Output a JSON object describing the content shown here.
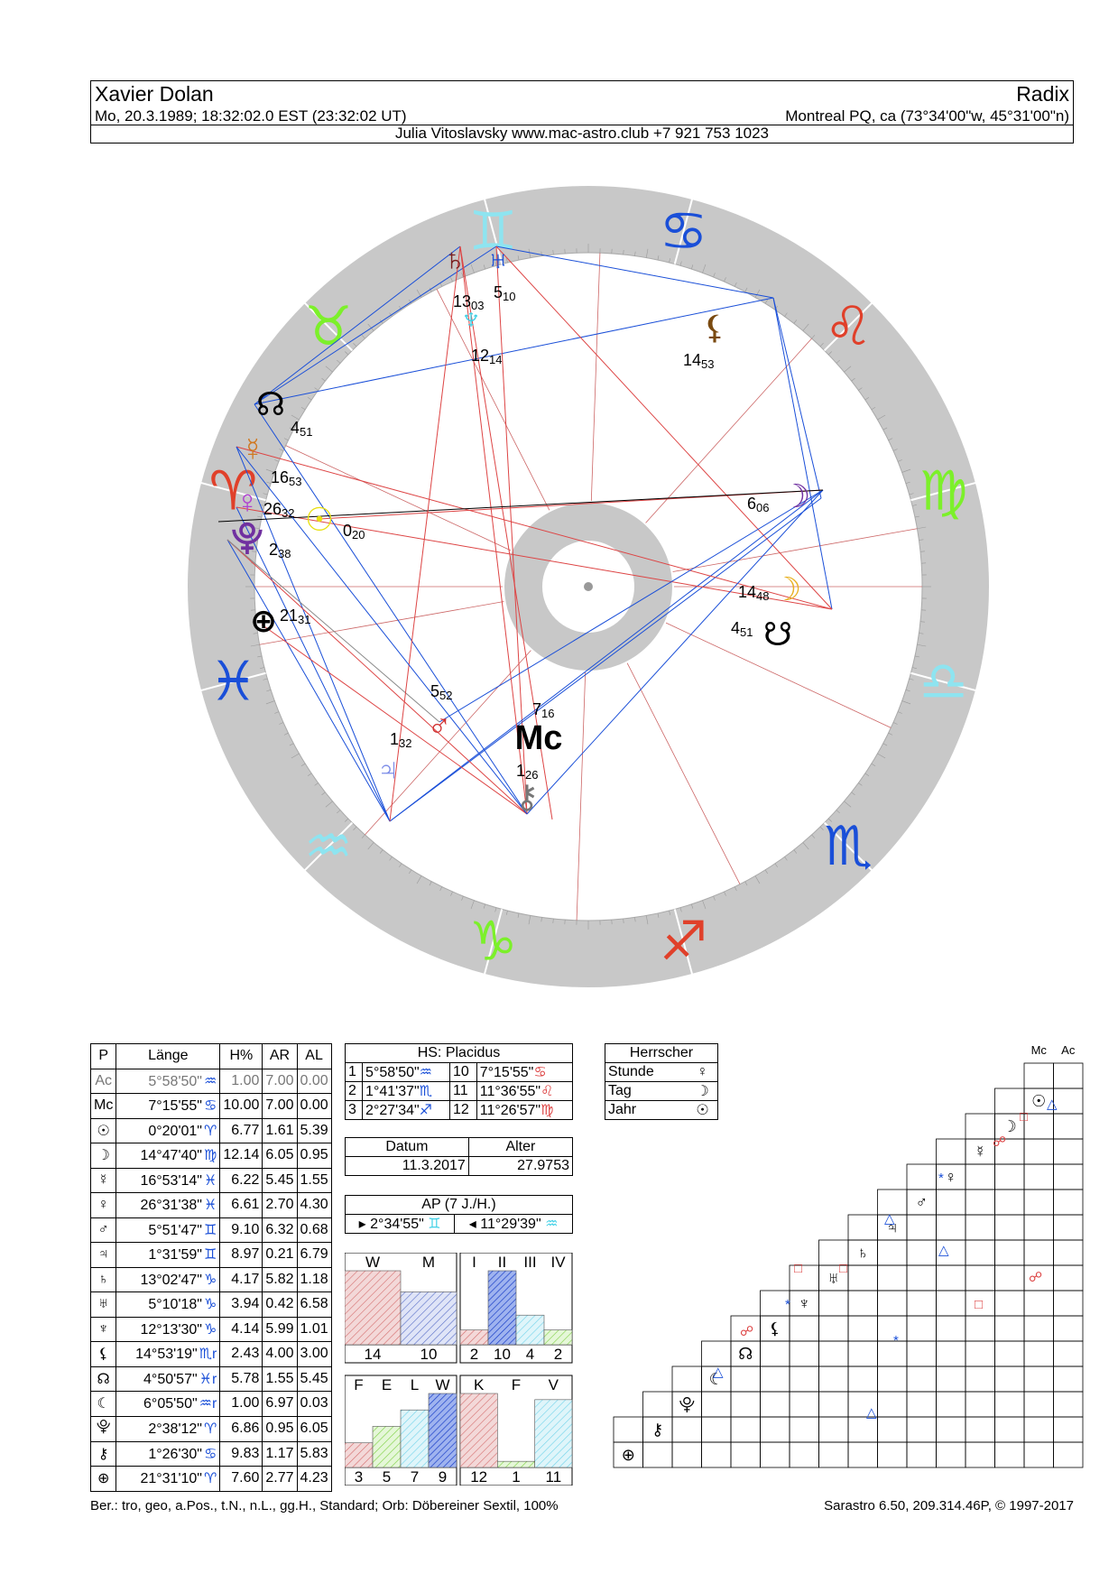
{
  "header": {
    "name": "Xavier Dolan",
    "chart_type": "Radix",
    "birth_line": "Mo, 20.3.1989; 18:32:02.0 EST (23:32:02 UT)",
    "place": "Montreal PQ, ca (73°34'00\"w, 45°31'00\"n)",
    "author": "Julia Vitoslavsky  www.mac-astro.club  +7 921 753 1023"
  },
  "wheel_labels": [
    {
      "glyph": "♄",
      "deg": "13",
      "min": "03"
    },
    {
      "glyph": "♅",
      "deg": "5",
      "min": "10"
    },
    {
      "glyph": "♆",
      "deg": "12",
      "min": "14"
    },
    {
      "glyph": "⚸",
      "deg": "14",
      "min": "53"
    },
    {
      "glyph": "☊",
      "deg": "4",
      "min": "51"
    },
    {
      "glyph": "☿",
      "deg": "16",
      "min": "53"
    },
    {
      "glyph": "♀",
      "deg": "26",
      "min": "32"
    },
    {
      "glyph": "☉",
      "deg": "0",
      "min": "20"
    },
    {
      "glyph": "⯓",
      "deg": "2",
      "min": "38"
    },
    {
      "glyph": "⊕",
      "deg": "21",
      "min": "31"
    },
    {
      "glyph": "☽",
      "deg": "6",
      "min": "06"
    },
    {
      "glyph": "☽",
      "deg": "14",
      "min": "48"
    },
    {
      "glyph": "☋",
      "deg": "4",
      "min": "51"
    },
    {
      "glyph": "♂",
      "deg": "5",
      "min": "52"
    },
    {
      "glyph": "",
      "deg": "7",
      "min": "16"
    },
    {
      "glyph": "♃",
      "deg": "1",
      "min": "32"
    },
    {
      "glyph": "⚷",
      "deg": "1",
      "min": "26"
    },
    {
      "glyph": "Mc",
      "deg": "",
      "min": ""
    }
  ],
  "planets_table": {
    "headers": [
      "P",
      "Länge",
      "H%",
      "AR",
      "AL"
    ],
    "rows": [
      {
        "p": "Ac",
        "lon": "5°58'50\"",
        "sign": "♒",
        "h": "1.00",
        "ar": "7.00",
        "al": "0.00",
        "grey": true
      },
      {
        "p": "Mc",
        "lon": "7°15'55\"",
        "sign": "♋",
        "h": "10.00",
        "ar": "7.00",
        "al": "0.00"
      },
      {
        "p": "☉",
        "lon": "0°20'01\"",
        "sign": "♈",
        "h": "6.77",
        "ar": "1.61",
        "al": "5.39"
      },
      {
        "p": "☽",
        "lon": "14°47'40\"",
        "sign": "♍",
        "h": "12.14",
        "ar": "6.05",
        "al": "0.95"
      },
      {
        "p": "☿",
        "lon": "16°53'14\"",
        "sign": "♓",
        "h": "6.22",
        "ar": "5.45",
        "al": "1.55"
      },
      {
        "p": "♀",
        "lon": "26°31'38\"",
        "sign": "♓",
        "h": "6.61",
        "ar": "2.70",
        "al": "4.30"
      },
      {
        "p": "♂",
        "lon": "5°51'47\"",
        "sign": "♊",
        "h": "9.10",
        "ar": "6.32",
        "al": "0.68"
      },
      {
        "p": "♃",
        "lon": "1°31'59\"",
        "sign": "♊",
        "h": "8.97",
        "ar": "0.21",
        "al": "6.79"
      },
      {
        "p": "♄",
        "lon": "13°02'47\"",
        "sign": "♑",
        "h": "4.17",
        "ar": "5.82",
        "al": "1.18"
      },
      {
        "p": "♅",
        "lon": "5°10'18\"",
        "sign": "♑",
        "h": "3.94",
        "ar": "0.42",
        "al": "6.58"
      },
      {
        "p": "♆",
        "lon": "12°13'30\"",
        "sign": "♑",
        "h": "4.14",
        "ar": "5.99",
        "al": "1.01"
      },
      {
        "p": "⚸",
        "lon": "14°53'19\"",
        "sign": "♏r",
        "h": "2.43",
        "ar": "4.00",
        "al": "3.00"
      },
      {
        "p": "☊",
        "lon": "4°50'57\"",
        "sign": "♓r",
        "h": "5.78",
        "ar": "1.55",
        "al": "5.45"
      },
      {
        "p": "☾",
        "lon": "6°05'50\"",
        "sign": "♒r",
        "h": "1.00",
        "ar": "6.97",
        "al": "0.03"
      },
      {
        "p": "⯓",
        "lon": "2°38'12\"",
        "sign": "♈",
        "h": "6.86",
        "ar": "0.95",
        "al": "6.05"
      },
      {
        "p": "⚷",
        "lon": "1°26'30\"",
        "sign": "♋",
        "h": "9.83",
        "ar": "1.17",
        "al": "5.83"
      },
      {
        "p": "⊕",
        "lon": "21°31'10\"",
        "sign": "♈",
        "h": "7.60",
        "ar": "2.77",
        "al": "4.23"
      }
    ]
  },
  "houses": {
    "title": "HS: Placidus",
    "rows": [
      {
        "a": "1",
        "av": "5°58'50\"",
        "as": "♒",
        "b": "10",
        "bv": "7°15'55\"",
        "bs": "♋"
      },
      {
        "a": "2",
        "av": "1°41'37\"",
        "as": "♏",
        "b": "11",
        "bv": "11°36'55\"",
        "bs": "♌"
      },
      {
        "a": "3",
        "av": "2°27'34\"",
        "as": "♐",
        "b": "12",
        "bv": "11°26'57\"",
        "bs": "♍"
      }
    ]
  },
  "datum": {
    "label": "Datum",
    "value": "11.3.2017",
    "alter_label": "Alter",
    "alter": "27.9753"
  },
  "ap": {
    "title": "AP (7 J./H.)",
    "left": "2°34'55\"",
    "left_sign": "♊",
    "right": "11°29'39\"",
    "right_sign": "♒"
  },
  "herrscher": {
    "title": "Herrscher",
    "rows": [
      {
        "k": "Stunde",
        "v": "♀"
      },
      {
        "k": "Tag",
        "v": "☽"
      },
      {
        "k": "Jahr",
        "v": "☉"
      }
    ]
  },
  "wm": {
    "labels": [
      "W",
      "M"
    ],
    "values": [
      "14",
      "10"
    ]
  },
  "quad": {
    "labels": [
      "I",
      "II",
      "III",
      "IV"
    ],
    "values": [
      "2",
      "10",
      "4",
      "2"
    ]
  },
  "felw": {
    "labels": [
      "F",
      "E",
      "L",
      "W"
    ],
    "values": [
      "3",
      "5",
      "7",
      "9"
    ]
  },
  "kfv": {
    "labels": [
      "K",
      "F",
      "V"
    ],
    "values": [
      "12",
      "1",
      "11"
    ]
  },
  "aspect_top": {
    "mc": "Mc",
    "ac": "Ac"
  },
  "footer": {
    "left": "Ber.: tro, geo, a.Pos., t.N., n.L., gg.H., Standard; Orb: Döbereiner Sextil, 100%",
    "right": "Sarastro 6.50, 209.314.46P, © 1997-2017"
  },
  "colors": {
    "fire": "#e0402a",
    "earth": "#7cf02a",
    "air": "#8ee4f0",
    "water": "#1a4fd8",
    "wheel": "#c8c8c8"
  }
}
